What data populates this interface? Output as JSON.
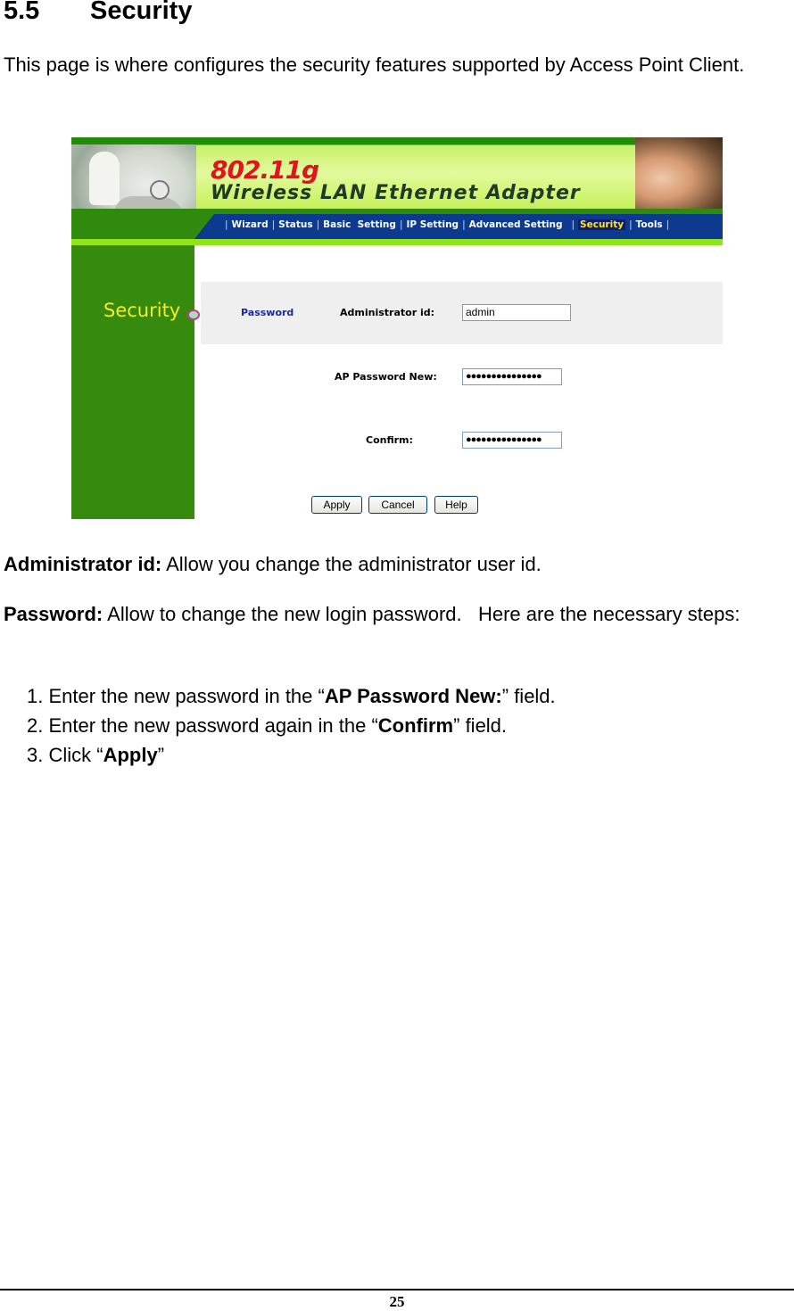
{
  "heading": {
    "number": "5.5",
    "title": "Security"
  },
  "intro": "This page is where configures the security features supported by Access Point Client.",
  "screenshot": {
    "brand_line1": "802.11g",
    "brand_line2": "Wireless LAN Ethernet Adapter",
    "nav": [
      {
        "label": "Wizard",
        "active": false
      },
      {
        "label": "Status",
        "active": false
      },
      {
        "label": "Basic  Setting",
        "active": false
      },
      {
        "label": "IP Setting",
        "active": false
      },
      {
        "label": "Advanced Setting",
        "active": false
      },
      {
        "label": "Security",
        "active": true
      },
      {
        "label": "Tools",
        "active": false
      }
    ],
    "sidebar_title": "Security",
    "section_label": "Password",
    "fields": {
      "admin_id": {
        "label": "Administrator id:",
        "value": "admin"
      },
      "new_password": {
        "label": "AP Password New:",
        "value": "●●●●●●●●●●●●●●●"
      },
      "confirm": {
        "label": "Confirm:",
        "value": "●●●●●●●●●●●●●●●"
      }
    },
    "buttons": {
      "apply": "Apply",
      "cancel": "Cancel",
      "help": "Help"
    },
    "colors": {
      "nav_bg": "#0b3a8e",
      "sidebar_bg": "#368a0d",
      "active_nav_text": "#ffe81a",
      "sidebar_title": "#f2ec2a"
    }
  },
  "descriptions": {
    "admin": {
      "term": "Administrator id:",
      "text": " Allow you change the administrator user id."
    },
    "password": {
      "term": "Password:",
      "text": " Allow to change the new login password.   Here are the necessary steps:"
    }
  },
  "steps": [
    {
      "pre": "1. Enter the new password in the “",
      "bold": "AP Password New:",
      "post": "” field."
    },
    {
      "pre": "2. Enter the new password again in the “",
      "bold": "Confirm",
      "post": "” field."
    },
    {
      "pre": "3. Click “",
      "bold": "Apply",
      "post": "”"
    }
  ],
  "footer": {
    "page_number": "25"
  }
}
